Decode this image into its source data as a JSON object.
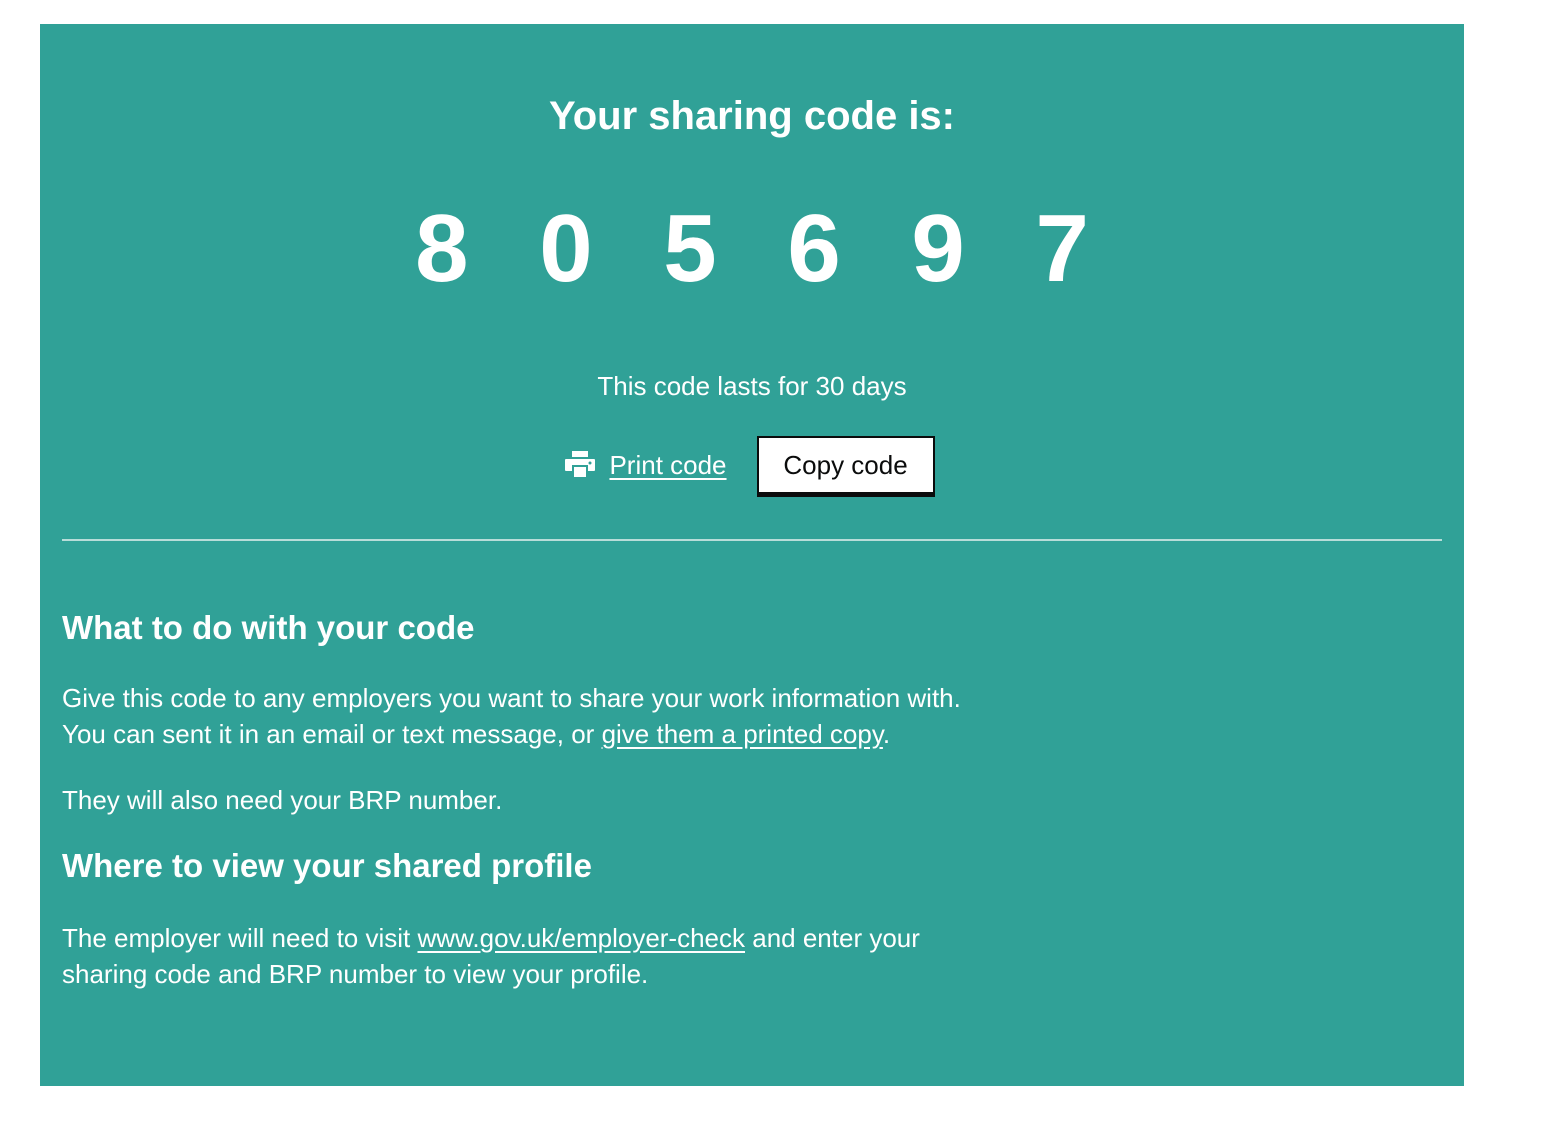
{
  "panel": {
    "background_color": "#30a197"
  },
  "code": {
    "title": "Your sharing code is:",
    "value": "8 0 5 6 9 7",
    "expiry": "This code lasts for 30 days"
  },
  "actions": {
    "print_icon": "printer-icon",
    "print_label": "Print code",
    "copy_label": "Copy code"
  },
  "what_to_do": {
    "heading": "What to do with your code",
    "para1_text": "Give this code to any employers you want to share your work information with. You can sent it in an email or text message, or ",
    "para1_link": "give them a printed copy",
    "para1_end": ".",
    "para2": "They will also need your BRP number."
  },
  "where_to_view": {
    "heading": "Where to view your shared profile",
    "para_start": "The employer will need to visit ",
    "para_link": "www.gov.uk/employer-check",
    "para_end": " and enter your sharing code and BRP number to view your profile."
  }
}
